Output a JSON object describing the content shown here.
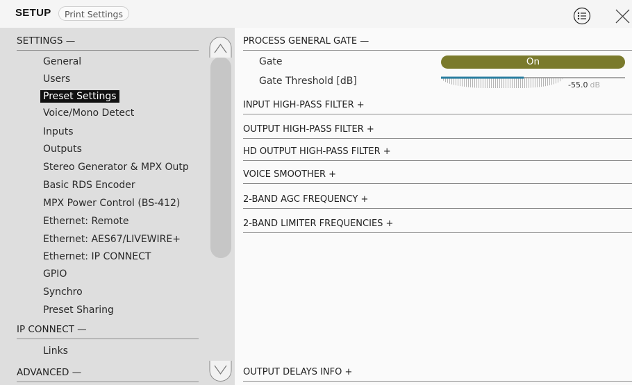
{
  "header": {
    "title": "SETUP",
    "print_button_label": "Print Settings"
  },
  "sidebar": {
    "sections": [
      {
        "label": "SETTINGS —"
      },
      {
        "label": "IP CONNECT —"
      },
      {
        "label": "ADVANCED —"
      }
    ],
    "settings_items": [
      {
        "label": "General"
      },
      {
        "label": "Users"
      },
      {
        "label": "Preset Settings"
      },
      {
        "label": "Voice/Mono Detect"
      },
      {
        "label": "Inputs"
      },
      {
        "label": "Outputs"
      },
      {
        "label": "Stereo Generator & MPX Outp"
      },
      {
        "label": "Basic RDS Encoder"
      },
      {
        "label": "MPX Power Control (BS-412)"
      },
      {
        "label": "Ethernet: Remote"
      },
      {
        "label": "Ethernet: AES67/LIVEWIRE+"
      },
      {
        "label": "Ethernet: IP CONNECT"
      },
      {
        "label": "GPIO"
      },
      {
        "label": "Synchro"
      },
      {
        "label": "Preset Sharing"
      }
    ],
    "ip_connect_items": [
      {
        "label": "Links"
      }
    ],
    "selected_item": "Preset Settings"
  },
  "main": {
    "gate_group": {
      "title": "PROCESS GENERAL GATE —",
      "gate_label": "Gate",
      "gate_value": "On",
      "threshold_label": "Gate Threshold [dB]",
      "threshold_value": "-55.0",
      "threshold_unit": "dB",
      "threshold_level": 0.45
    },
    "groups": [
      {
        "title": "INPUT HIGH-PASS FILTER +"
      },
      {
        "title": "OUTPUT HIGH-PASS FILTER +"
      },
      {
        "title": "HD OUTPUT HIGH-PASS FILTER +"
      },
      {
        "title": "VOICE SMOOTHER +"
      },
      {
        "title": "2-BAND AGC FREQUENCY +"
      },
      {
        "title": "2-BAND LIMITER FREQUENCIES +"
      }
    ],
    "bottom_group": {
      "title": "OUTPUT DELAYS INFO +"
    }
  },
  "colors": {
    "toggle_on": "#7a7a2c",
    "slider_fill": "#2a7ea0",
    "sidebar_bg": "#dedede",
    "main_bg": "#fafafa"
  },
  "icons": {
    "menu": "list-menu-icon",
    "close": "close-icon",
    "scroll_up": "chevron-up-icon",
    "scroll_down": "chevron-down-icon"
  }
}
